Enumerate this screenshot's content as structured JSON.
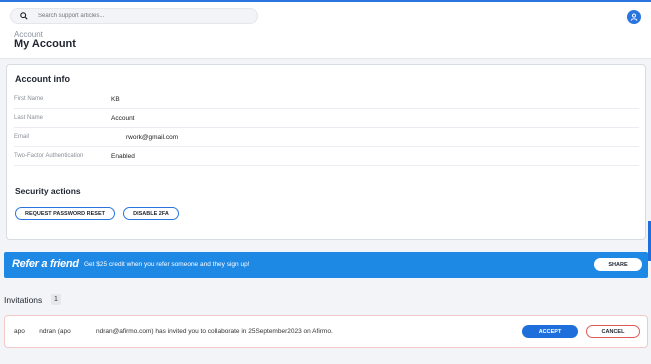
{
  "search": {
    "placeholder": "Search support articles..."
  },
  "header": {
    "breadcrumb": "Account",
    "title": "My Account"
  },
  "account_info": {
    "title": "Account info",
    "rows": [
      {
        "label": "First Name",
        "value": "KB"
      },
      {
        "label": "Last Name",
        "value": "Account"
      },
      {
        "label": "Email",
        "value": "rwork@gmail.com"
      },
      {
        "label": "Two-Factor Authentication",
        "value": "Enabled"
      }
    ]
  },
  "security": {
    "title": "Security actions",
    "reset_label": "REQUEST PASSWORD RESET",
    "disable_2fa_label": "DISABLE 2FA"
  },
  "referral": {
    "title": "Refer a friend",
    "description": "Get $25 credit when you refer someone and they sign up!",
    "share_label": "SHARE"
  },
  "invitations": {
    "title": "Invitations",
    "count": "1",
    "items": [
      {
        "text": "apo        ndran (apo              ndran@afirmo.com) has invited you to collaborate in 25September2023 on Afirmo.",
        "accept_label": "ACCEPT",
        "cancel_label": "CANCEL"
      }
    ]
  },
  "colors": {
    "accent": "#1e88e5",
    "primary": "#1e6fdc",
    "danger": "#e05a5a"
  }
}
